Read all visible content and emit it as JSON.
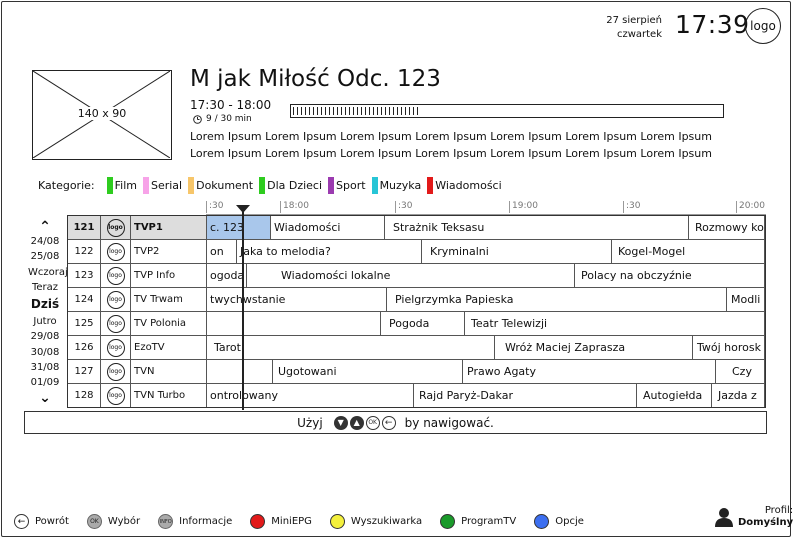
{
  "header": {
    "date": "27 sierpień",
    "weekday": "czwartek",
    "time": "17:39",
    "logo": "logo"
  },
  "program": {
    "thumbnail_label": "140 x 90",
    "title": "M jak Miłość Odc. 123",
    "time_range": "17:30 - 18:00",
    "duration": "9 / 30 min",
    "progress_fraction": 0.3,
    "description": "Lorem Ipsum Lorem Ipsum Lorem Ipsum Lorem Ipsum Lorem Ipsum Lorem Ipsum Lorem Ipsum Lorem Ipsum Lorem Ipsum Lorem Ipsum Lorem Ipsum Lorem Ipsum Lorem Ipsum Lorem Ipsum"
  },
  "categories": {
    "label": "Kategorie:",
    "items": [
      {
        "name": "Film",
        "color": "#2ecc1f"
      },
      {
        "name": "Serial",
        "color": "#f7a3e8"
      },
      {
        "name": "Dokument",
        "color": "#f7c66a"
      },
      {
        "name": "Dla Dzieci",
        "color": "#2ecc1f"
      },
      {
        "name": "Sport",
        "color": "#9b3bb0"
      },
      {
        "name": "Muzyka",
        "color": "#27c5d6"
      },
      {
        "name": "Wiadomości",
        "color": "#e21a1a"
      }
    ]
  },
  "dates": {
    "items": [
      "24/08",
      "25/08",
      "Wczoraj",
      "Teraz",
      "Dziś",
      "Jutro",
      "29/08",
      "30/08",
      "31/08",
      "01/09"
    ],
    "selected": "Dziś"
  },
  "timeline": [
    ":30",
    "18:00",
    ":30",
    "19:00",
    ":30",
    "20:00"
  ],
  "guide": {
    "rows": [
      {
        "num": "121",
        "logo": "logo",
        "channel": "TVP1",
        "programs": [
          "c. 123",
          "Wiadomości",
          "Strażnik Teksasu",
          "Rozmowy ko"
        ]
      },
      {
        "num": "122",
        "logo": "logo",
        "channel": "TVP2",
        "programs": [
          "on",
          "Jaka to melodia?",
          "Kryminalni",
          "Kogel-Mogel"
        ]
      },
      {
        "num": "123",
        "logo": "logo",
        "channel": "TVP Info",
        "programs": [
          "ogoda",
          "Wiadomości lokalne",
          "Polacy na obczyźnie"
        ]
      },
      {
        "num": "124",
        "logo": "logo",
        "channel": "TV Trwam",
        "programs": [
          "twychwstanie",
          "Pielgrzymka Papieska",
          "Modli"
        ]
      },
      {
        "num": "125",
        "logo": "logo",
        "channel": "TV Polonia",
        "programs": [
          "",
          "Pogoda",
          "Teatr Telewizji"
        ]
      },
      {
        "num": "126",
        "logo": "logo",
        "channel": "EzoTV",
        "programs": [
          "Tarot",
          "Wróż Maciej Zaprasza",
          "Twój horosk"
        ]
      },
      {
        "num": "127",
        "logo": "logo",
        "channel": "TVN",
        "programs": [
          "",
          "Ugotowani",
          "Prawo Agaty",
          "Czy"
        ]
      },
      {
        "num": "128",
        "logo": "logo",
        "channel": "TVN Turbo",
        "programs": [
          "ontrolowany",
          "Rajd Paryż-Dakar",
          "Autogiełda",
          "Jazda z"
        ]
      }
    ]
  },
  "hint": {
    "prefix": "Użyj",
    "ok": "OK",
    "suffix": "by nawigować."
  },
  "footer": {
    "items": [
      {
        "label": "Powrót",
        "icon": "back-arrow-icon"
      },
      {
        "label": "Wybór",
        "icon": "ok-icon",
        "glyph": "OK"
      },
      {
        "label": "Informacje",
        "icon": "info-icon",
        "glyph": "INFO"
      },
      {
        "label": "MiniEPG",
        "color": "#e21a1a"
      },
      {
        "label": "Wyszukiwarka",
        "color": "#f4f03c"
      },
      {
        "label": "ProgramTV",
        "color": "#1a9a2a"
      },
      {
        "label": "Opcje",
        "color": "#3c6ff0"
      }
    ],
    "profile_label": "Profil:",
    "profile_name": "Domyślny"
  }
}
